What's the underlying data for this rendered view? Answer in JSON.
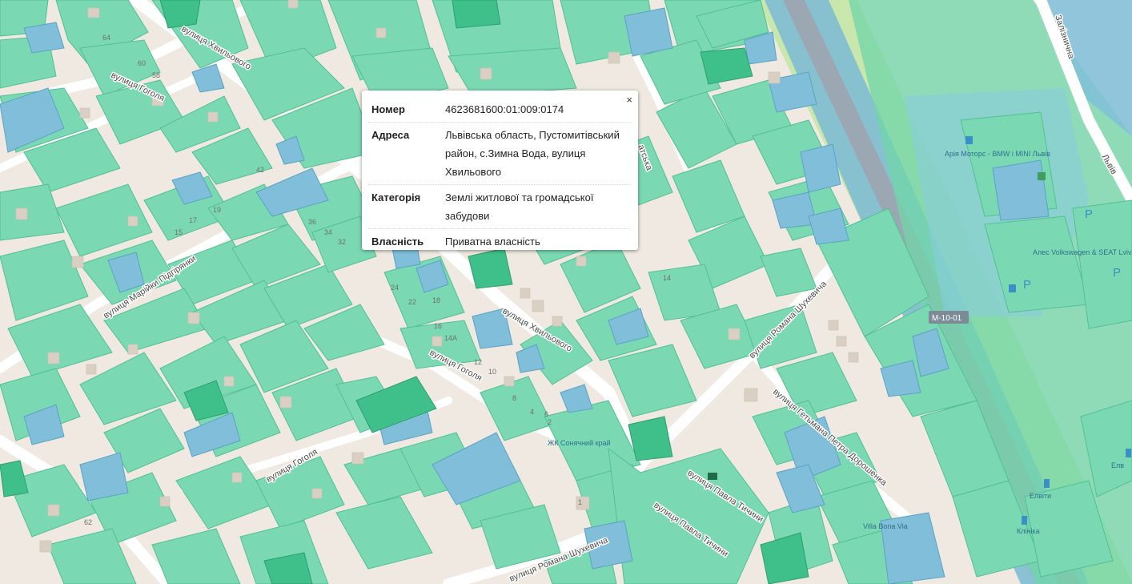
{
  "popup": {
    "close_label": "×",
    "rows": [
      {
        "label": "Номер",
        "value": "4623681600:01:009:0174"
      },
      {
        "label": "Адреса",
        "value": "Львівська область, Пустомитівський район, с.Зимна Вода, вулиця Хвильового"
      },
      {
        "label": "Категорія",
        "value": "Землі житлової та громадської забудови"
      },
      {
        "label": "Власність",
        "value": "Приватна власність"
      }
    ]
  },
  "map": {
    "streets": {
      "khvylovoho_top": "вулиця Хвильового",
      "khvylovoho_mid": "вулиця Хвильового",
      "hoholia_top": "вулиця Гоголя",
      "hoholia_mid": "вулиця Гоголя",
      "hoholia_low": "вулиця Гоголя",
      "pidhirianky": "вулиця Марійки Підгірянки",
      "shukhevycha_mid": "вулиця Романа Шухевича",
      "shukhevycha_low": "вулиця Романа Шухевича",
      "doroshenka": "вулиця Гетьмана Петра Дорошенка",
      "tychyny_a": "вулиця Павла Тичини",
      "tychyny_b": "вулиця Павла Тичини",
      "zaliznychna": "Залізнична",
      "lvivska": "Львів",
      "partial_street": "атська"
    },
    "road_shield": "М-10-01",
    "pois": {
      "complex": "ЖК Сонячний край",
      "dealer_bmw": "Арія Моторс - BMW і MINI Львів",
      "dealer_vw": "Алес Volkswagen & SEAT Lviv",
      "villa": "Villa Bona Via",
      "stop_a": "Елвіти",
      "stop_b": "Клініка",
      "stop_c": "Елв"
    },
    "house_numbers": [
      "64",
      "60",
      "58",
      "42",
      "36",
      "34",
      "32",
      "24",
      "22",
      "18",
      "16",
      "14А",
      "14",
      "12",
      "10",
      "8",
      "6",
      "4",
      "2",
      "1",
      "62",
      "15",
      "17",
      "19"
    ],
    "colors": {
      "background": "#efe9e1",
      "parcel_green": "#7ad9b3",
      "parcel_blue": "#80bed9",
      "parcel_dark": "#3fbf8a",
      "railway": "#9aa7b2",
      "embankment": "#c7e6a0"
    }
  }
}
